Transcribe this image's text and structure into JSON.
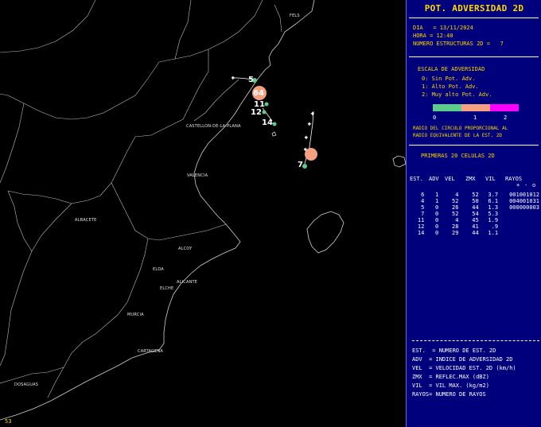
{
  "map": {
    "frame_number": "53",
    "cities": [
      {
        "id": "city-fels",
        "label": "FELS"
      },
      {
        "id": "city-castellon",
        "label": "CASTELLON-DE-LA-PLANA"
      },
      {
        "id": "city-valencia",
        "label": "VALENCIA"
      },
      {
        "id": "city-albacete",
        "label": "ALBACETE"
      },
      {
        "id": "city-alicante",
        "label": "ALICANTE"
      },
      {
        "id": "city-elda",
        "label": "ELDA"
      },
      {
        "id": "city-elche",
        "label": "ELCHE"
      },
      {
        "id": "city-murcia",
        "label": "MURCIA"
      },
      {
        "id": "city-cartagena",
        "label": "CARTAGENA"
      },
      {
        "id": "city-dosaguas",
        "label": "DOSAGUAS"
      },
      {
        "id": "city-alcoy",
        "label": "ALCOY"
      }
    ],
    "cells": [
      {
        "id": "5",
        "label": "5",
        "adv": 0,
        "color": "#5ccc8a"
      },
      {
        "id": "6",
        "label": "6",
        "adv": 1,
        "color": "#f5a080"
      },
      {
        "id": "4",
        "label": "4",
        "adv": 1,
        "color": "#f5a080"
      },
      {
        "id": "11",
        "label": "11",
        "adv": 0,
        "color": "#5ccc8a"
      },
      {
        "id": "12",
        "label": "12",
        "adv": 0,
        "color": "#5ccc8a"
      },
      {
        "id": "14",
        "label": "14",
        "adv": 0,
        "color": "#5ccc8a"
      },
      {
        "id": "7",
        "label": "7",
        "adv": 0,
        "color": "#5ccc8a"
      }
    ]
  },
  "panel": {
    "title": "POT. ADVERSIDAD 2D",
    "dia_line": "DIA   = 13/11/2024",
    "hora_line": "HORA = 12:40",
    "num_line": "NUMERO ESTRUCTURAS 2D =   7",
    "scale_title": "ESCALA DE ADVERSIDAD",
    "scale_items": [
      "0: Sin Pot. Adv.",
      "1: Alto Pot. Adv.",
      "2: Muy alto Pot. Adv."
    ],
    "scale_colors": [
      "#5ccc8a",
      "#f5a080",
      "#ff00ff"
    ],
    "scale_ticks": [
      "0",
      "1",
      "2"
    ],
    "radius_note_1": "RADIO DEL CIRCULO PROPORCIONAL AL",
    "radius_note_2": "RADIO EQUIVALENTE DE LA EST. 2D",
    "cells_title": "PRIMERAS 20 CELULAS 2D",
    "columns": [
      "EST.",
      "ADV",
      "VEL",
      "ZMX",
      "VIL",
      "RAYOS"
    ],
    "rayos_sub": [
      "+",
      "-",
      "o"
    ],
    "rows": [
      [
        "6",
        "1",
        "4",
        "52",
        "3.7",
        "001001012"
      ],
      [
        "4",
        "1",
        "52",
        "50",
        "6.1",
        "004001031"
      ],
      [
        "5",
        "0",
        "26",
        "44",
        "1.3",
        "000000003"
      ],
      [
        "7",
        "0",
        "52",
        "54",
        "5.3",
        ""
      ],
      [
        "11",
        "0",
        "4",
        "45",
        "1.9",
        ""
      ],
      [
        "12",
        "0",
        "28",
        "41",
        ".9",
        ""
      ],
      [
        "14",
        "0",
        "29",
        "44",
        "1.1",
        ""
      ]
    ],
    "legend": [
      "EST.  = NUMERO DE EST. 2D",
      "ADV  = INDICE DE ADVERSIDAD 2D",
      "VEL  = VELOCIDAD EST. 2D (km/h)",
      "ZMX  = REFLEC.MAX (dBZ)",
      "VIL  = VIL MAX. (kg/m2)",
      "RAYOS= NUMERO DE RAYOS"
    ]
  }
}
